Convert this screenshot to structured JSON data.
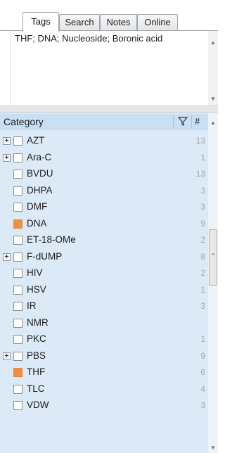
{
  "tabs": [
    {
      "label": "Tags",
      "active": true
    },
    {
      "label": "Search",
      "active": false
    },
    {
      "label": "Notes",
      "active": false
    },
    {
      "label": "Online",
      "active": false
    }
  ],
  "tags_text": "THF; DNA; Nucleoside; Boronic acid",
  "category": {
    "header_label": "Category",
    "count_header": "#",
    "filter_icon": "filter-icon",
    "items": [
      {
        "label": "AZT",
        "count": "13",
        "expandable": true,
        "color": null
      },
      {
        "label": "Ara-C",
        "count": "1",
        "expandable": true,
        "color": null
      },
      {
        "label": "BVDU",
        "count": "13",
        "expandable": false,
        "color": null
      },
      {
        "label": "DHPA",
        "count": "3",
        "expandable": false,
        "color": null
      },
      {
        "label": "DMF",
        "count": "3",
        "expandable": false,
        "color": null
      },
      {
        "label": "DNA",
        "count": "9",
        "expandable": false,
        "color": "#f0903f"
      },
      {
        "label": "ET-18-OMe",
        "count": "2",
        "expandable": false,
        "color": null
      },
      {
        "label": "F-dUMP",
        "count": "8",
        "expandable": true,
        "color": null
      },
      {
        "label": "HIV",
        "count": "2",
        "expandable": false,
        "color": null
      },
      {
        "label": "HSV",
        "count": "1",
        "expandable": false,
        "color": null
      },
      {
        "label": "IR",
        "count": "3",
        "expandable": false,
        "color": null
      },
      {
        "label": "NMR",
        "count": "",
        "expandable": false,
        "color": null
      },
      {
        "label": "PKC",
        "count": "1",
        "expandable": false,
        "color": null
      },
      {
        "label": "PBS",
        "count": "9",
        "expandable": true,
        "color": null
      },
      {
        "label": "THF",
        "count": "6",
        "expandable": false,
        "color": "#f0903f"
      },
      {
        "label": "TLC",
        "count": "4",
        "expandable": false,
        "color": null
      },
      {
        "label": "VDW",
        "count": "3",
        "expandable": false,
        "color": null
      }
    ]
  },
  "colors": {
    "list_background": "#dce9f6",
    "header_background": "#c9dff3",
    "tag_color": "#f0903f"
  }
}
